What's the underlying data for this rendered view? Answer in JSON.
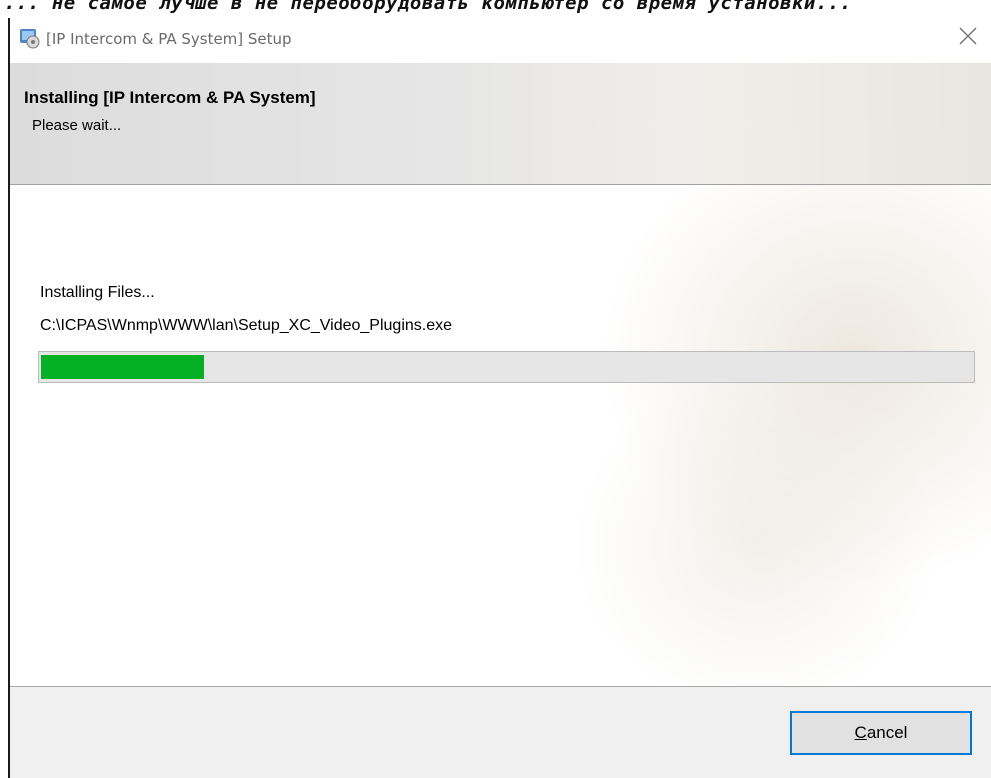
{
  "overlay": {
    "text": "... не самое лучше в не переоборудовать компьютер со время установки..."
  },
  "window": {
    "title": "[IP Intercom & PA System] Setup",
    "icon": "installer-icon"
  },
  "header": {
    "title": "Installing [IP Intercom & PA System]",
    "subtitle": "Please wait..."
  },
  "progress": {
    "status": "Installing Files...",
    "current_file": "C:\\ICPAS\\Wnmp\\WWW\\lan\\Setup_XC_Video_Plugins.exe",
    "fraction": 0.175,
    "fill_color": "#06b025"
  },
  "footer": {
    "cancel_mnemonic": "C",
    "cancel_rest": "ancel"
  }
}
